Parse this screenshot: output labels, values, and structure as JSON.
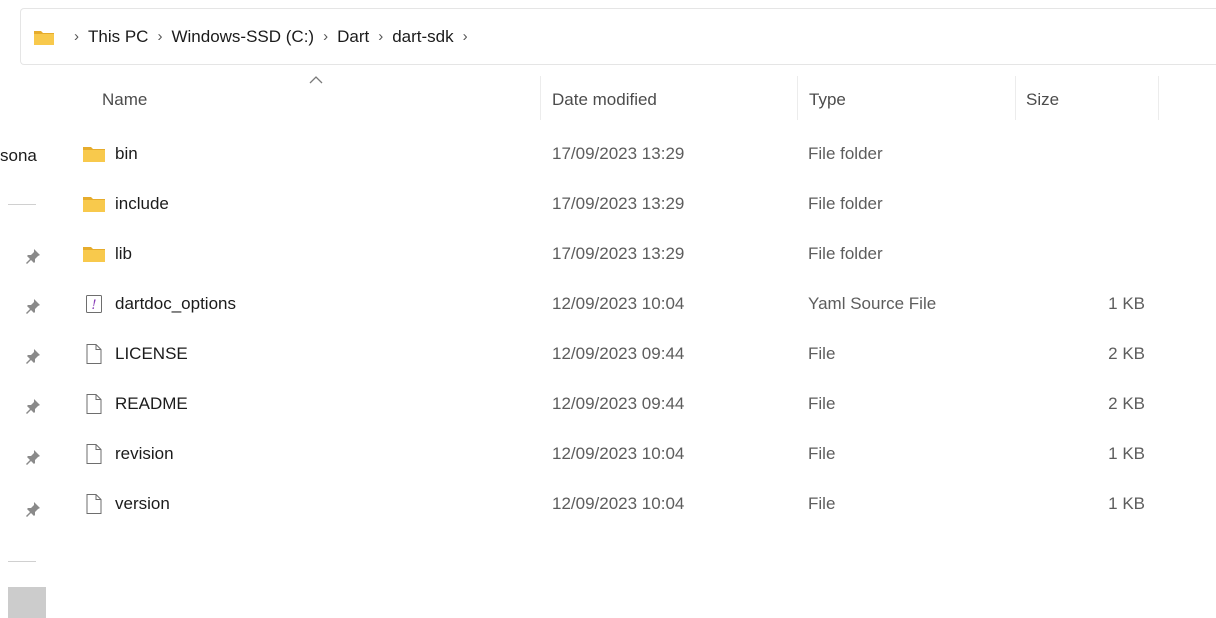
{
  "address": {
    "crumbs": [
      "This PC",
      "Windows-SSD (C:)",
      "Dart",
      "dart-sdk"
    ],
    "separator": "›"
  },
  "nav": {
    "partial_label": "sona"
  },
  "columns": {
    "name": "Name",
    "date": "Date modified",
    "type": "Type",
    "size": "Size"
  },
  "files": [
    {
      "name": "bin",
      "date": "17/09/2023 13:29",
      "type": "File folder",
      "size": "",
      "icon": "folder-icon"
    },
    {
      "name": "include",
      "date": "17/09/2023 13:29",
      "type": "File folder",
      "size": "",
      "icon": "folder-icon"
    },
    {
      "name": "lib",
      "date": "17/09/2023 13:29",
      "type": "File folder",
      "size": "",
      "icon": "folder-icon"
    },
    {
      "name": "dartdoc_options",
      "date": "12/09/2023 10:04",
      "type": "Yaml Source File",
      "size": "1 KB",
      "icon": "yaml-file-icon"
    },
    {
      "name": "LICENSE",
      "date": "12/09/2023 09:44",
      "type": "File",
      "size": "2 KB",
      "icon": "file-icon"
    },
    {
      "name": "README",
      "date": "12/09/2023 09:44",
      "type": "File",
      "size": "2 KB",
      "icon": "file-icon"
    },
    {
      "name": "revision",
      "date": "12/09/2023 10:04",
      "type": "File",
      "size": "1 KB",
      "icon": "file-icon"
    },
    {
      "name": "version",
      "date": "12/09/2023 10:04",
      "type": "File",
      "size": "1 KB",
      "icon": "file-icon"
    }
  ],
  "colors": {
    "folder": "#f8c94c",
    "folder_dark": "#e6ac2c",
    "yaml_accent": "#8a3fb8"
  }
}
